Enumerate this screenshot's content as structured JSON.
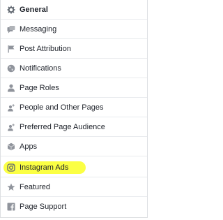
{
  "sidebar": {
    "items": [
      {
        "label": "General",
        "icon": "gear-icon"
      },
      {
        "label": "Messaging",
        "icon": "messaging-icon"
      },
      {
        "label": "Post Attribution",
        "icon": "flag-icon"
      },
      {
        "label": "Notifications",
        "icon": "globe-icon"
      },
      {
        "label": "Page Roles",
        "icon": "person-icon"
      },
      {
        "label": "People and Other Pages",
        "icon": "person-add-icon"
      },
      {
        "label": "Preferred Page Audience",
        "icon": "person-add-icon"
      },
      {
        "label": "Apps",
        "icon": "apps-cube-icon"
      },
      {
        "label": "Instagram Ads",
        "icon": "instagram-icon"
      },
      {
        "label": "Featured",
        "icon": "star-icon"
      },
      {
        "label": "Page Support",
        "icon": "facebook-icon"
      }
    ],
    "highlight_color": "#fbff3a",
    "icon_color": "#90949c"
  }
}
